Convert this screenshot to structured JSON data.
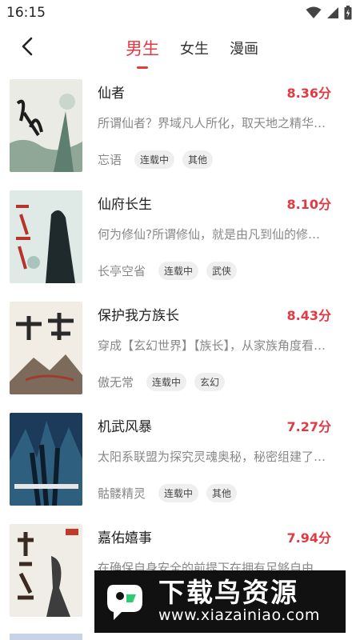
{
  "status_bar": {
    "time": "16:15"
  },
  "header": {
    "tabs": [
      {
        "label": "男生",
        "active": true
      },
      {
        "label": "女生",
        "active": false
      },
      {
        "label": "漫画",
        "active": false
      }
    ]
  },
  "books": [
    {
      "title": "仙者",
      "score": "8.36分",
      "desc": "所谓仙者？界域凡人所化，取天地之精华，修得",
      "author": "忘语",
      "tags": [
        "连载中",
        "其他"
      ]
    },
    {
      "title": "仙府长生",
      "score": "8.10分",
      "desc": "何为修仙?所谓修仙，就是由凡到仙的修行之路",
      "author": "长亭空省",
      "tags": [
        "连载中",
        "武侠"
      ]
    },
    {
      "title": "保护我方族长",
      "score": "8.43分",
      "desc": "穿成【玄幻世界】【族长】，从家族角度看世界",
      "author": "傲无常",
      "tags": [
        "连载中",
        "玄幻"
      ]
    },
    {
      "title": "机武风暴",
      "score": "7.27分",
      "desc": "太阳系联盟为探究灵魂奥秘，秘密组建了一支",
      "author": "骷髅精灵",
      "tags": [
        "连载中",
        "其他"
      ]
    },
    {
      "title": "嘉佑嬉事",
      "score": "7.94分",
      "desc": "在确保自身安全的前提下在拥有足够自由的情",
      "author": "",
      "tags": []
    }
  ],
  "watermark": {
    "name": "下载鸟资源",
    "url": "www.xiazainiao.com"
  },
  "colors": {
    "accent": "#e23a43",
    "text_muted": "#888888",
    "tag_bg": "#efefef"
  }
}
